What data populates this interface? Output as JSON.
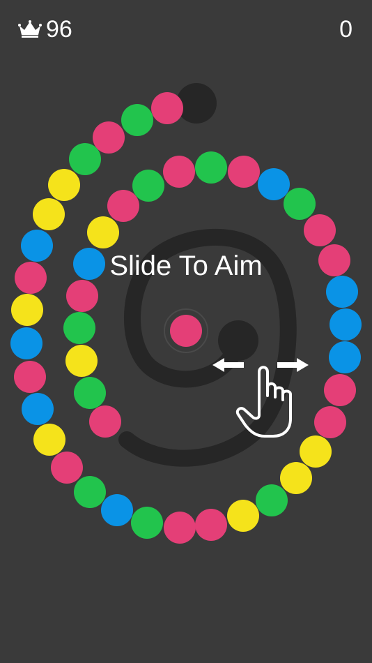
{
  "hud": {
    "best_score": "96",
    "score": "0",
    "best_icon": "crown-icon"
  },
  "hint": {
    "text": "Slide To Aim",
    "gesture_icon": "swipe-left-right-hand-icon"
  },
  "colors": {
    "background": "#3a3a3a",
    "track": "#262626",
    "pink": "#e43f77",
    "green": "#22c44d",
    "blue": "#0a93e6",
    "yellow": "#f5e31b"
  },
  "game": {
    "shooter_ball_color": "pink",
    "chain_colors": [
      "pink",
      "green",
      "pink",
      "green",
      "yellow",
      "yellow",
      "blue",
      "pink",
      "yellow",
      "blue",
      "pink",
      "blue",
      "yellow",
      "pink",
      "green",
      "blue",
      "green",
      "pink",
      "pink",
      "yellow",
      "green",
      "yellow",
      "yellow",
      "pink",
      "pink",
      "blue",
      "blue",
      "blue",
      "pink",
      "pink",
      "green",
      "blue",
      "pink",
      "green",
      "pink",
      "green",
      "pink",
      "yellow",
      "blue",
      "pink",
      "green",
      "yellow",
      "green",
      "pink"
    ]
  }
}
